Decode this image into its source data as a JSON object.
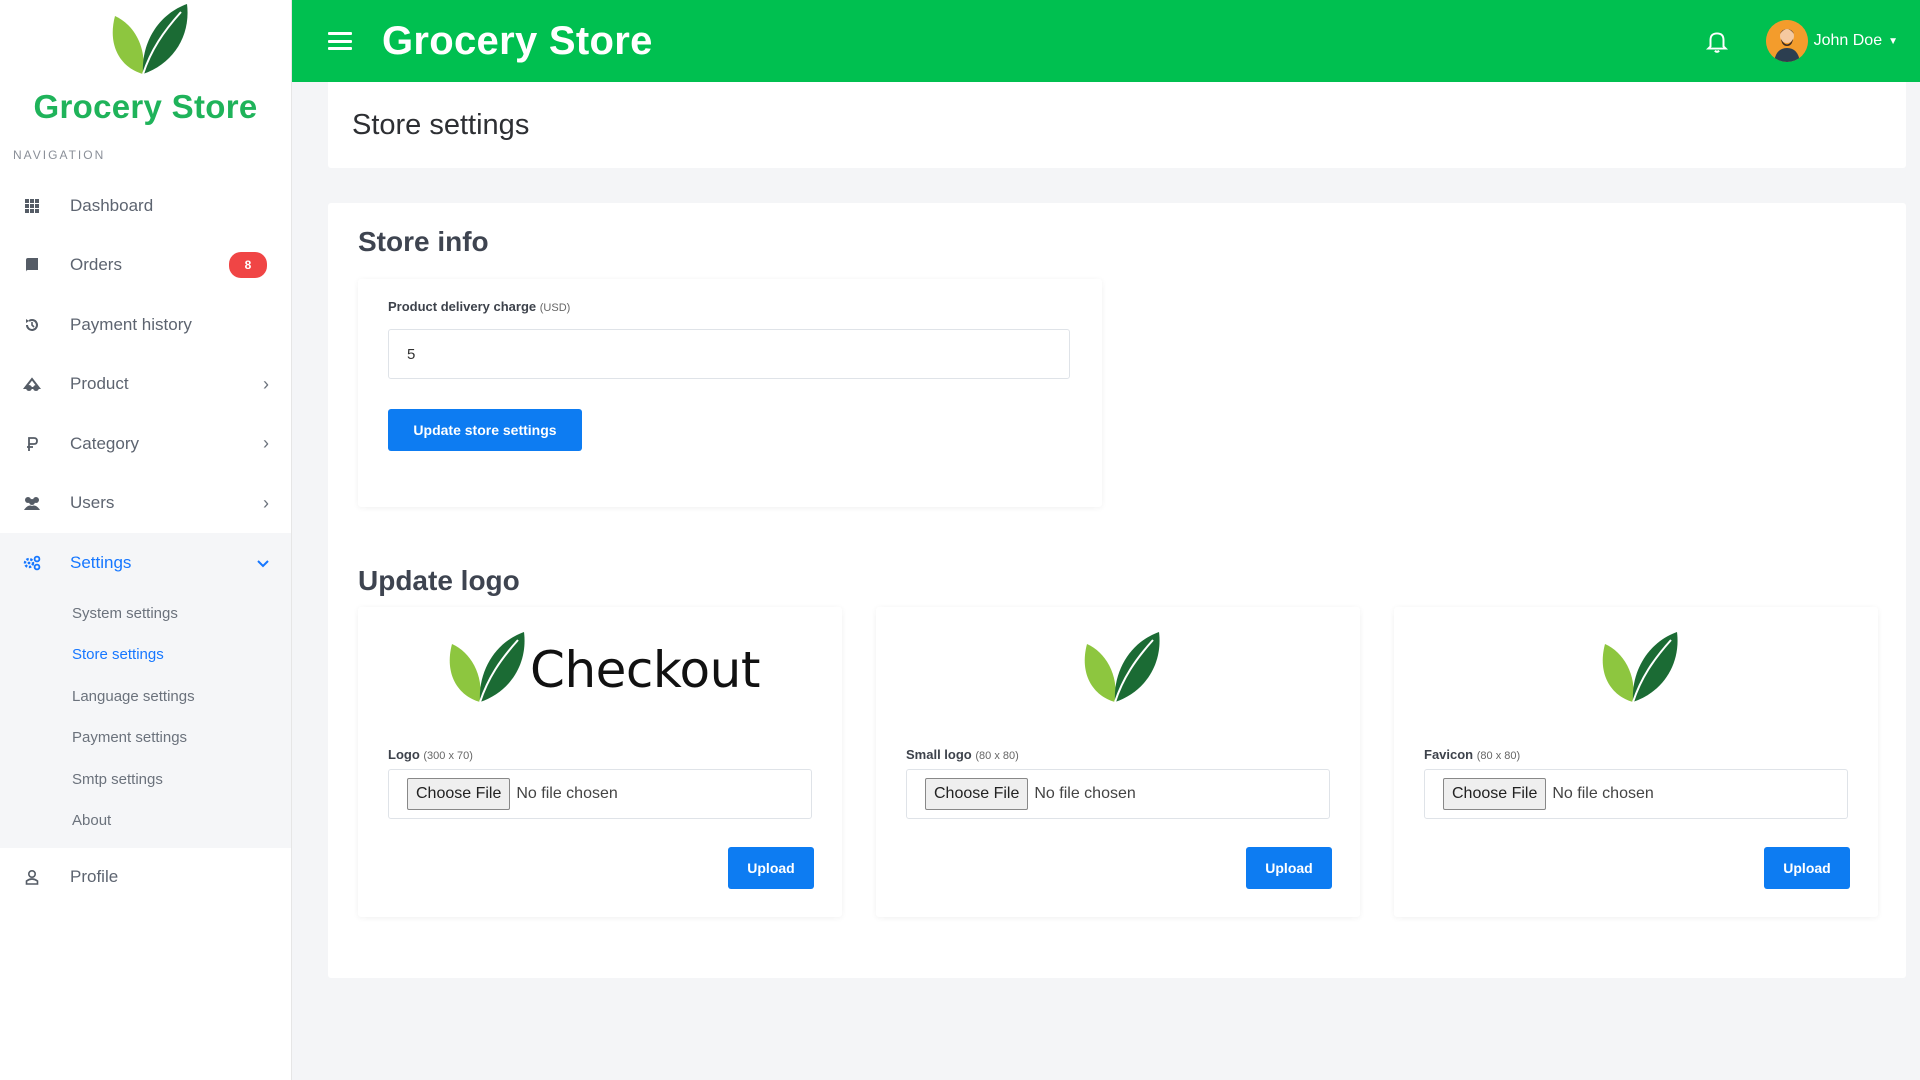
{
  "brand": {
    "name": "Grocery Store"
  },
  "nav": {
    "header": "NAVIGATION",
    "items": [
      {
        "label": "Dashboard"
      },
      {
        "label": "Orders",
        "badge": "8"
      },
      {
        "label": "Payment history"
      },
      {
        "label": "Product"
      },
      {
        "label": "Category"
      },
      {
        "label": "Users"
      },
      {
        "label": "Settings"
      },
      {
        "label": "Profile"
      }
    ],
    "settings_sub": [
      {
        "label": "System settings"
      },
      {
        "label": "Store settings"
      },
      {
        "label": "Language settings"
      },
      {
        "label": "Payment settings"
      },
      {
        "label": "Smtp settings"
      },
      {
        "label": "About"
      }
    ]
  },
  "topbar": {
    "title": "Grocery Store",
    "user_name": "John Doe"
  },
  "page": {
    "title": "Store settings"
  },
  "store_info": {
    "title": "Store info",
    "delivery_label": "Product delivery charge",
    "delivery_unit": "(USD)",
    "delivery_value": "5",
    "update_button": "Update store settings"
  },
  "update_logo": {
    "title": "Update logo",
    "preview_text": "Checkout",
    "cards": [
      {
        "label": "Logo",
        "size": "(300 x 70)",
        "choose": "Choose File",
        "status": "No file chosen",
        "upload": "Upload"
      },
      {
        "label": "Small logo",
        "size": "(80 x 80)",
        "choose": "Choose File",
        "status": "No file chosen",
        "upload": "Upload"
      },
      {
        "label": "Favicon",
        "size": "(80 x 80)",
        "choose": "Choose File",
        "status": "No file chosen",
        "upload": "Upload"
      }
    ]
  },
  "colors": {
    "primary_green": "#00c050",
    "brand_green": "#1fb35a",
    "accent_blue": "#0d7cf2",
    "badge_red": "#f04545"
  },
  "icons": [
    "leaf-logo-icon",
    "hamburger-icon",
    "bell-icon",
    "avatar",
    "grid-icon",
    "book-icon",
    "history-icon",
    "product-icon",
    "category-icon",
    "users-icon",
    "settings-icon",
    "user-icon",
    "chevron-right-icon",
    "chevron-down-icon"
  ]
}
